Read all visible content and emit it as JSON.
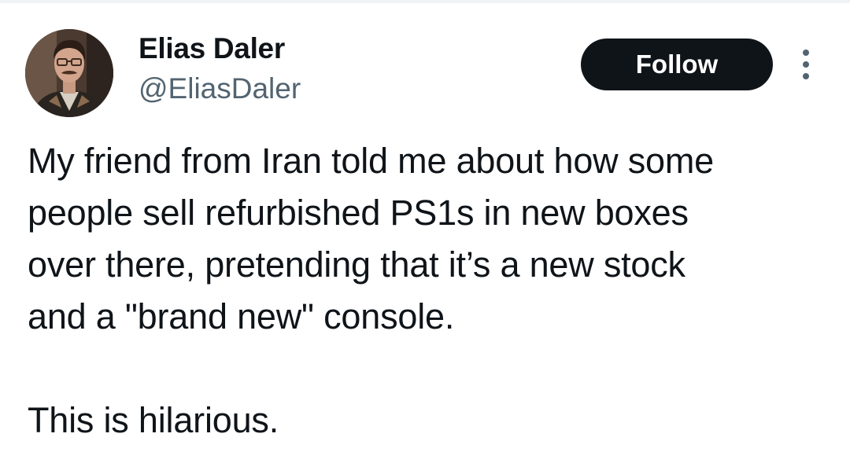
{
  "author": {
    "display_name": "Elias Daler",
    "handle": "@EliasDaler",
    "avatar_icon": "profile-photo"
  },
  "actions": {
    "follow_label": "Follow",
    "more_icon": "more-vertical-icon"
  },
  "tweet": {
    "lines": [
      "My friend from Iran told me about how some",
      "people sell refurbished PS1s in new boxes",
      "over there, pretending that it’s a new stock",
      "and a \"brand new\" console."
    ],
    "closing_line": "This is hilarious."
  },
  "colors": {
    "text_primary": "#0f1419",
    "text_secondary": "#536471",
    "button_bg": "#0f1419",
    "button_text": "#ffffff",
    "background": "#ffffff"
  }
}
